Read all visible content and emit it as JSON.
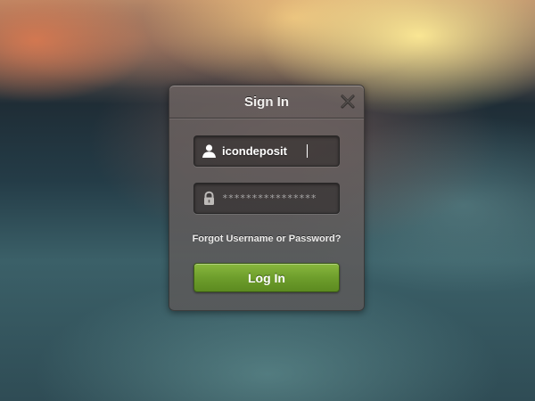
{
  "dialog": {
    "title": "Sign In",
    "close_icon": "close-icon"
  },
  "username": {
    "icon": "user-icon",
    "value": "icondeposit"
  },
  "password": {
    "icon": "lock-icon",
    "masked_value": "****************"
  },
  "forgot_link": "Forgot Username or Password?",
  "login_button": {
    "label": "Log In",
    "color": "#6e9e2c"
  }
}
